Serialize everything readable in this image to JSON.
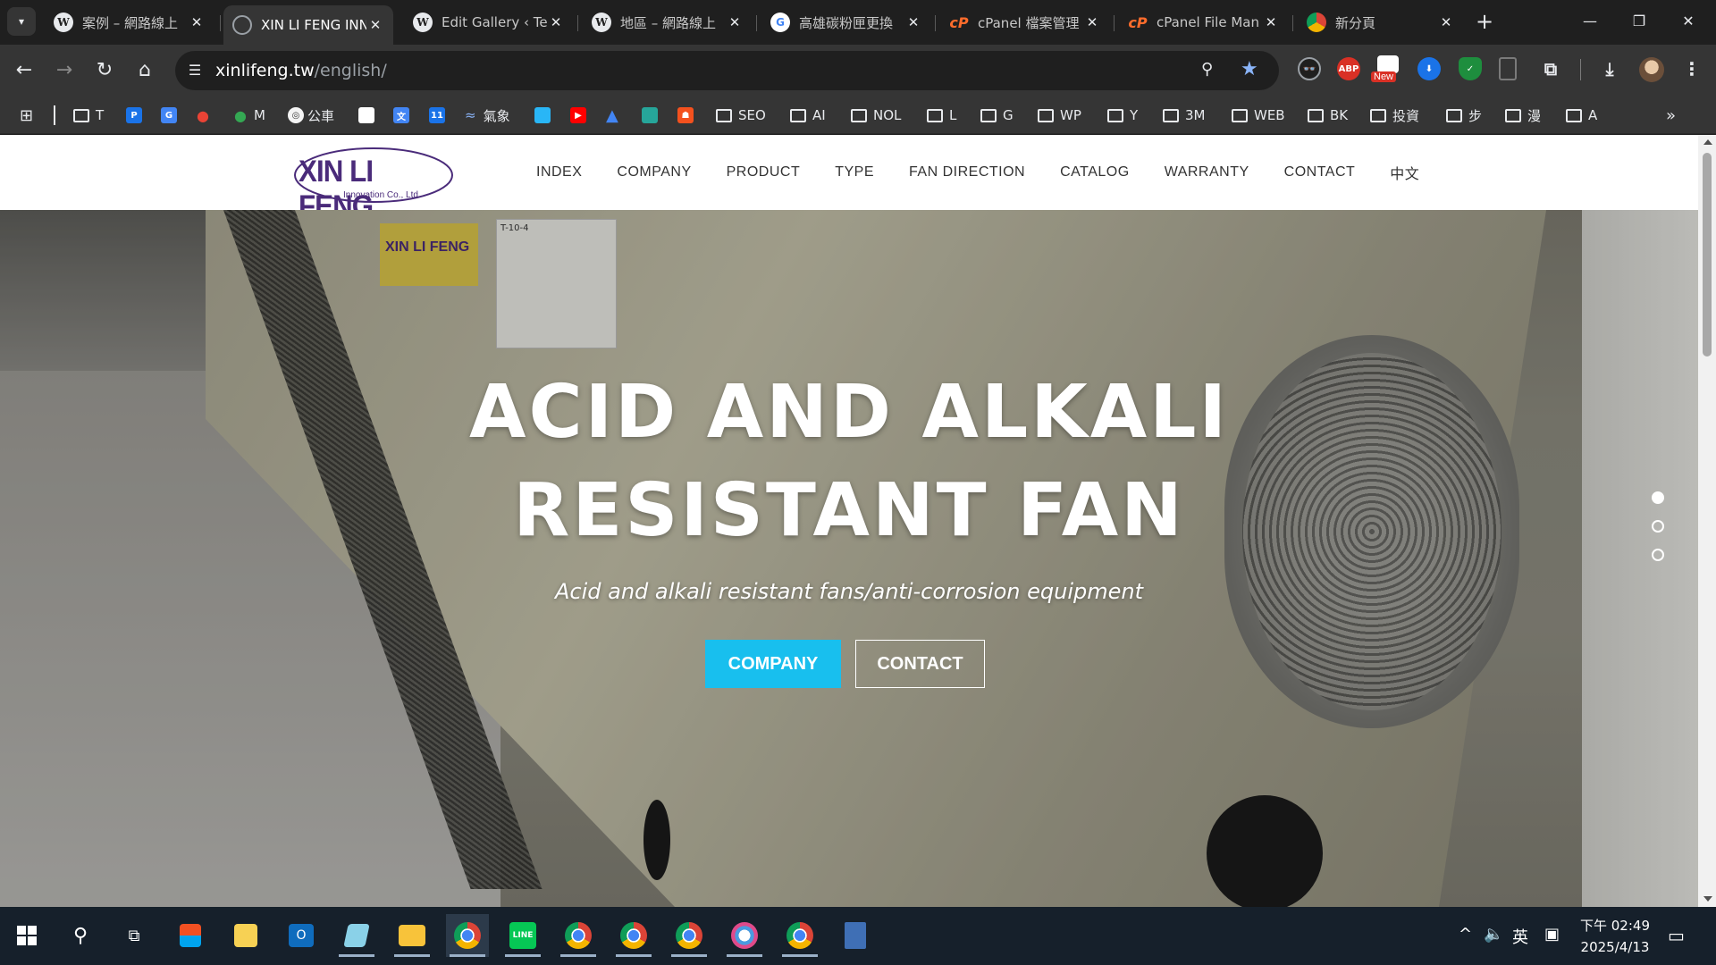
{
  "browser": {
    "tabs": [
      {
        "title": "案例 – 網路線上",
        "favicon": "wordpress-icon",
        "active": false
      },
      {
        "title": "XIN LI FENG INN",
        "favicon": "globe-icon",
        "active": true
      },
      {
        "title": "Edit Gallery ‹ Te",
        "favicon": "wordpress-icon",
        "active": false
      },
      {
        "title": "地區 – 網路線上",
        "favicon": "wordpress-icon",
        "active": false
      },
      {
        "title": "高雄碳粉匣更換",
        "favicon": "google-icon",
        "active": false
      },
      {
        "title": "cPanel 檔案管理",
        "favicon": "cpanel-icon",
        "active": false
      },
      {
        "title": "cPanel File Man",
        "favicon": "cpanel-icon",
        "active": false
      },
      {
        "title": "新分頁",
        "favicon": "chrome-icon",
        "active": false
      }
    ],
    "url_host": "xinlifeng.tw",
    "url_path": "/english/",
    "extensions": {
      "abp": "ABP",
      "new_badge": "New"
    },
    "bookmarks": [
      {
        "label": "T",
        "type": "folder"
      },
      {
        "label": "M",
        "type": "maps"
      },
      {
        "label": "公車",
        "type": "site"
      },
      {
        "label": "氣象",
        "type": "site"
      },
      {
        "label": "SEO",
        "type": "folder"
      },
      {
        "label": "AI",
        "type": "folder"
      },
      {
        "label": "NOL",
        "type": "folder"
      },
      {
        "label": "L",
        "type": "folder"
      },
      {
        "label": "G",
        "type": "folder"
      },
      {
        "label": "WP",
        "type": "folder"
      },
      {
        "label": "Y",
        "type": "folder"
      },
      {
        "label": "3M",
        "type": "folder"
      },
      {
        "label": "WEB",
        "type": "folder"
      },
      {
        "label": "BK",
        "type": "folder"
      },
      {
        "label": "投資",
        "type": "folder"
      },
      {
        "label": "步",
        "type": "folder"
      },
      {
        "label": "漫",
        "type": "folder"
      },
      {
        "label": "A",
        "type": "folder"
      }
    ]
  },
  "site": {
    "logo_text": "XIN LI FENG",
    "logo_sub": "Innovation Co., Ltd.",
    "nav": [
      "INDEX",
      "COMPANY",
      "PRODUCT",
      "TYPE",
      "FAN DIRECTION",
      "CATALOG",
      "WARRANTY",
      "CONTACT",
      "中文"
    ],
    "hero": {
      "title_line1": "ACID AND ALKALI",
      "title_line2": "RESISTANT FAN",
      "subtitle": "Acid and alkali resistant fans/anti-corrosion equipment",
      "btn_primary": "COMPANY",
      "btn_secondary": "CONTACT",
      "slides": 3,
      "active_slide": 1,
      "plate_text": "XIN LI FENG",
      "label_text": "T-10-4"
    },
    "accent_color": "#18bfee",
    "logo_color": "#4a2b7a"
  },
  "taskbar": {
    "ime": "英",
    "time": "下午 02:49",
    "date": "2025/4/13"
  }
}
